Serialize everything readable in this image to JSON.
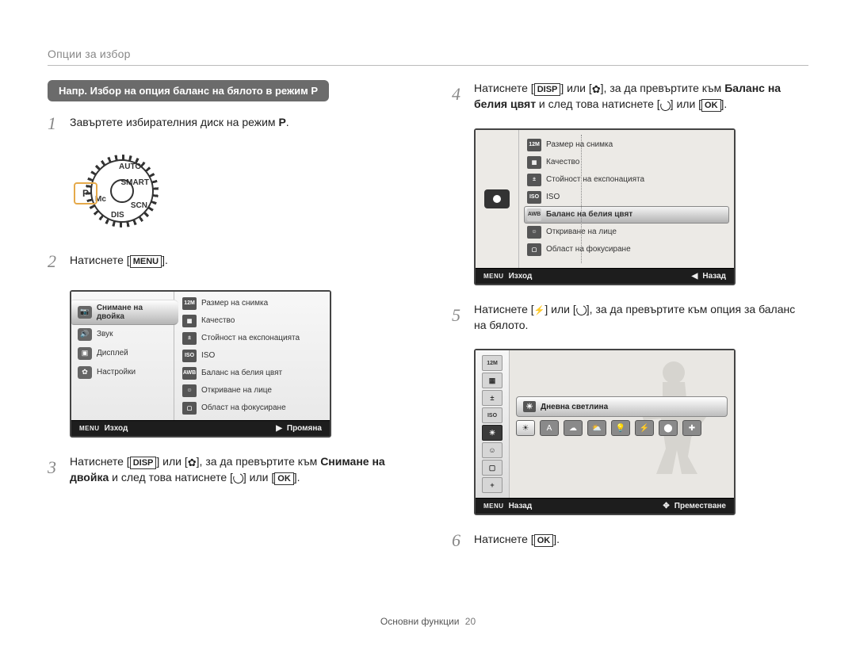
{
  "header": {
    "title": "Опции за избор"
  },
  "example_heading": "Напр. Избор на опция баланс на бялото в режим P",
  "p_letter": "P",
  "dial_labels": {
    "auto": "AUTO",
    "scn": "SCN",
    "dis": "DIS",
    "smart": "SMART",
    "mc": "Mc"
  },
  "steps": {
    "s1": {
      "num": "1",
      "text_a": "Завъртете избирателния диск на режим ",
      "p": "P",
      "tail": "."
    },
    "s2": {
      "num": "2",
      "text_a": "Натиснете [",
      "btn": "MENU",
      "text_b": "]."
    },
    "s3": {
      "num": "3",
      "t1": "Натиснете [",
      "btn1": "DISP",
      "t2": "] или [",
      "t3": "], за да превъртите към ",
      "bold": "Снимане на двойка",
      "t4": " и след това натиснете [",
      "t5": "] или [",
      "btn2": "OK",
      "t6": "]."
    },
    "s4": {
      "num": "4",
      "t1": "Натиснете [",
      "btn1": "DISP",
      "t2": "] или [",
      "t3": "], за да превъртите към ",
      "bold": "Баланс на белия цвят",
      "t4": " и след това натиснете [",
      "t5": "] или [",
      "btn2": "OK",
      "t6": "]."
    },
    "s5": {
      "num": "5",
      "t1": "Натиснете [",
      "t2": "] или [",
      "t3": "], за да превъртите към опция за баланс на бялото."
    },
    "s6": {
      "num": "6",
      "t1": "Натиснете [",
      "btn": "OK",
      "t2": "]."
    }
  },
  "screenA": {
    "tabs": [
      {
        "icon": "📷",
        "label": "Снимане на двойка",
        "active": true
      },
      {
        "icon": "🔊",
        "label": "Звук"
      },
      {
        "icon": "▣",
        "label": "Дисплей"
      },
      {
        "icon": "✿",
        "label": "Настройки"
      }
    ],
    "menu": [
      {
        "icon": "12M",
        "label": "Размер на снимка"
      },
      {
        "icon": "▦",
        "label": "Качество"
      },
      {
        "icon": "±",
        "label": "Стойност на експонацията"
      },
      {
        "icon": "ISO",
        "label": "ISO"
      },
      {
        "icon": "AWB",
        "label": "Баланс на белия цвят"
      },
      {
        "icon": "☺",
        "label": "Откриване на лице"
      },
      {
        "icon": "▢",
        "label": "Област на фокусиране"
      }
    ],
    "footer": {
      "left_label": "MENU",
      "left_text": "Изход",
      "right_glyph": "▶",
      "right_text": "Промяна"
    }
  },
  "screenC": {
    "menu": [
      {
        "icon": "12M",
        "label": "Размер на снимка"
      },
      {
        "icon": "▦",
        "label": "Качество"
      },
      {
        "icon": "±",
        "label": "Стойност на експонацията"
      },
      {
        "icon": "ISO",
        "label": "ISO"
      },
      {
        "icon": "AWB",
        "label": "Баланс на белия цвят",
        "selected": true
      },
      {
        "icon": "☺",
        "label": "Откриване на лице"
      },
      {
        "icon": "▢",
        "label": "Област на фокусиране"
      }
    ],
    "footer": {
      "left_label": "MENU",
      "left_text": "Изход",
      "right_glyph": "◀",
      "right_text": "Назад"
    }
  },
  "screenB": {
    "vstrip": [
      "12M",
      "▦",
      "±",
      "ISO",
      "☀",
      "☺",
      "▢",
      "+"
    ],
    "selected_label": "Дневна светлина",
    "footer": {
      "left_label": "MENU",
      "left_text": "Назад",
      "right_glyph": "✥",
      "right_text": "Преместване"
    }
  },
  "footer": {
    "section": "Основни функции",
    "page": "20"
  }
}
